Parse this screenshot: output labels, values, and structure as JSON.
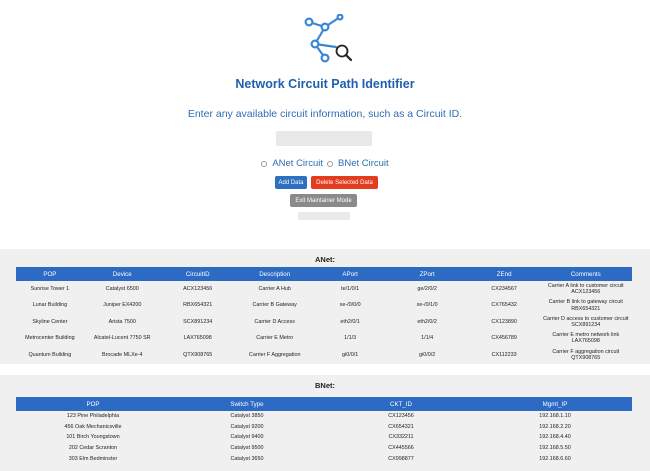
{
  "header": {
    "title": "Network Circuit Path Identifier",
    "subtitle": "Enter any available circuit information, such as a Circuit ID.",
    "search_placeholder": ""
  },
  "circuit_selector": {
    "anet_label": "ANet Circuit",
    "bnet_label": "BNet Circuit"
  },
  "buttons": {
    "add_label": "Add Data",
    "delete_label": "Delete Selected Data",
    "exit_label": "Exit Maintainer Mode",
    "hidden_label": ""
  },
  "colors": {
    "primary_blue": "#2c6ac4",
    "danger_red": "#e23b1e",
    "neutral_gray": "#8a8a8a",
    "title_blue": "#1f5fae"
  },
  "anet": {
    "title": "ANet:",
    "columns": [
      "POP",
      "Device",
      "CircuitID",
      "Description",
      "APort",
      "ZPort",
      "ZEnd",
      "Comments"
    ],
    "rows": [
      [
        "Sunrise Tower 1",
        "Catalyst 6500",
        "ACX123456",
        "Carrier A Hub",
        "te/1/0/1",
        "ge/2/0/2",
        "CX234567",
        "Carrier A link to customer circuit ACX123456"
      ],
      [
        "Lunar Building",
        "Juniper EX4200",
        "RBX654321",
        "Carrier B Gateway",
        "xe-/0/0/0",
        "xe-/0/1/0",
        "CX765432",
        "Carrier B link to gateway circuit RBX654321"
      ],
      [
        "Skyline Center",
        "Arista 7500",
        "SCX891234",
        "Carrier D Access",
        "eth2/0/1",
        "eth2/0/2",
        "CX123890",
        "Carrier D access to customer circuit SCX891234"
      ],
      [
        "Metrocenter Building",
        "Alcatel-Lucent 7750 SR",
        "LAX765098",
        "Carrier E Metro",
        "1/1/3",
        "1/1/4",
        "CX456789",
        "Carrier E metro network link LAX765098"
      ],
      [
        "Quantum Building",
        "Brocade MLXe-4",
        "QTX908765",
        "Carrier F Aggregation",
        "gi0/0/1",
        "gi0/0/2",
        "CX112233",
        "Carrier F aggregation circuit QTX908765"
      ]
    ]
  },
  "bnet": {
    "title": "BNet:",
    "columns": [
      "POP",
      "Switch Type",
      "CKT_ID",
      "Mgmt_IP"
    ],
    "rows": [
      [
        "123 Pine Philadelphia",
        "Catalyst 3850",
        "CX123456",
        "192.168.1.10"
      ],
      [
        "456 Oak Mechanicsville",
        "Catalyst 9200",
        "CX654321",
        "192.168.2.20"
      ],
      [
        "101 Birch Youngstown",
        "Catalyst 9400",
        "CX332211",
        "192.168.4.40"
      ],
      [
        "202 Cedar Scranton",
        "Catalyst 9500",
        "CX445566",
        "192.168.5.50"
      ],
      [
        "303 Elm Bedminster",
        "Catalyst 3650",
        "CX998877",
        "192.168.6.60"
      ]
    ]
  }
}
